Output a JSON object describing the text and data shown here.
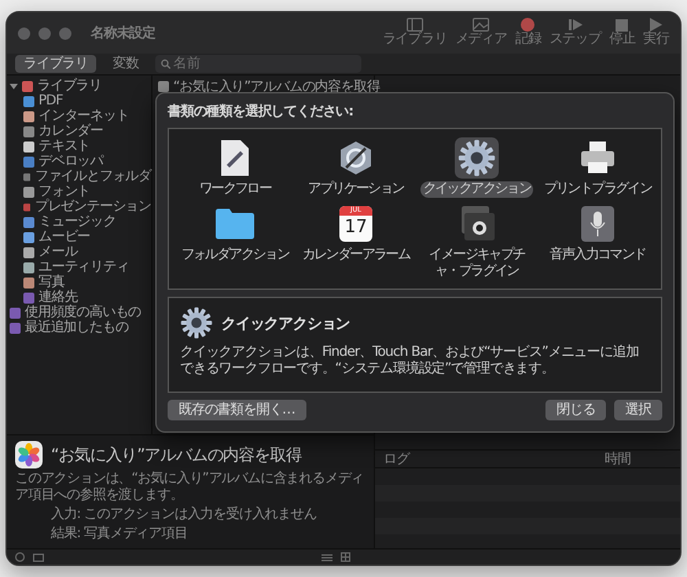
{
  "window": {
    "title": "名称未設定"
  },
  "toolbar": [
    {
      "label": "ライブラリ",
      "kind": "library"
    },
    {
      "label": "メディア",
      "kind": "media"
    },
    {
      "label": "記録",
      "kind": "record"
    },
    {
      "label": "ステップ",
      "kind": "step"
    },
    {
      "label": "停止",
      "kind": "stop"
    },
    {
      "label": "実行",
      "kind": "run"
    }
  ],
  "view_switch": [
    {
      "label": "ライブラリ",
      "selected": true
    },
    {
      "label": "変数",
      "selected": false
    }
  ],
  "search": {
    "placeholder": "名前"
  },
  "sidebar": {
    "items": [
      {
        "label": "ライブラリ",
        "expanded": true,
        "children": [
          {
            "label": "PDF"
          },
          {
            "label": "インターネット"
          },
          {
            "label": "カレンダー"
          },
          {
            "label": "テキスト"
          },
          {
            "label": "デベロッパ"
          },
          {
            "label": "ファイルとフォルダ"
          },
          {
            "label": "フォント"
          },
          {
            "label": "プレゼンテーション"
          },
          {
            "label": "ミュージック"
          },
          {
            "label": "ムービー"
          },
          {
            "label": "メール"
          },
          {
            "label": "ユーティリティ"
          },
          {
            "label": "写真"
          },
          {
            "label": "連絡先"
          }
        ]
      },
      {
        "label": "使用頻度の高いもの"
      },
      {
        "label": "最近追加したもの"
      }
    ]
  },
  "actions": [
    {
      "label": "“お気に入り”アルバムの内容を取得"
    }
  ],
  "description": {
    "title": "“お気に入り”アルバムの内容を取得",
    "text": "このアクションは、“お気に入り”アルバムに含まれるメディア項目への参照を渡します。",
    "input": "入力: このアクションは入力を受け入れません",
    "result": "結果: 写真メディア項目"
  },
  "log": {
    "columns": [
      "ログ",
      "時間"
    ]
  },
  "dialog": {
    "title": "書類の種類を選択してください:",
    "types": [
      {
        "label": "ワークフロー",
        "kind": "workflow",
        "selected": false
      },
      {
        "label": "アプリケーション",
        "kind": "application",
        "selected": false
      },
      {
        "label": "クイックアクション",
        "kind": "gear",
        "selected": true
      },
      {
        "label": "プリントプラグイン",
        "kind": "printer",
        "selected": false
      },
      {
        "label": "フォルダアクション",
        "kind": "folder",
        "selected": false
      },
      {
        "label": "カレンダーアラーム",
        "kind": "calendar",
        "selected": false,
        "icon_month": "JUL",
        "icon_day": "17"
      },
      {
        "label": "イメージキャプチャ・プラグイン",
        "kind": "camera",
        "selected": false
      },
      {
        "label": "音声入力コマンド",
        "kind": "microphone",
        "selected": false
      }
    ],
    "detail": {
      "title": "クイックアクション",
      "text": "クイックアクションは、Finder、Touch Bar、および“サービス”メニューに追加できるワークフローです。“システム環境設定”で管理できます。"
    },
    "buttons": [
      {
        "label": "既存の書類を開く…",
        "kind": "secondary"
      },
      {
        "label": "閉じる",
        "kind": "default"
      },
      {
        "label": "選択",
        "kind": "default"
      }
    ]
  }
}
